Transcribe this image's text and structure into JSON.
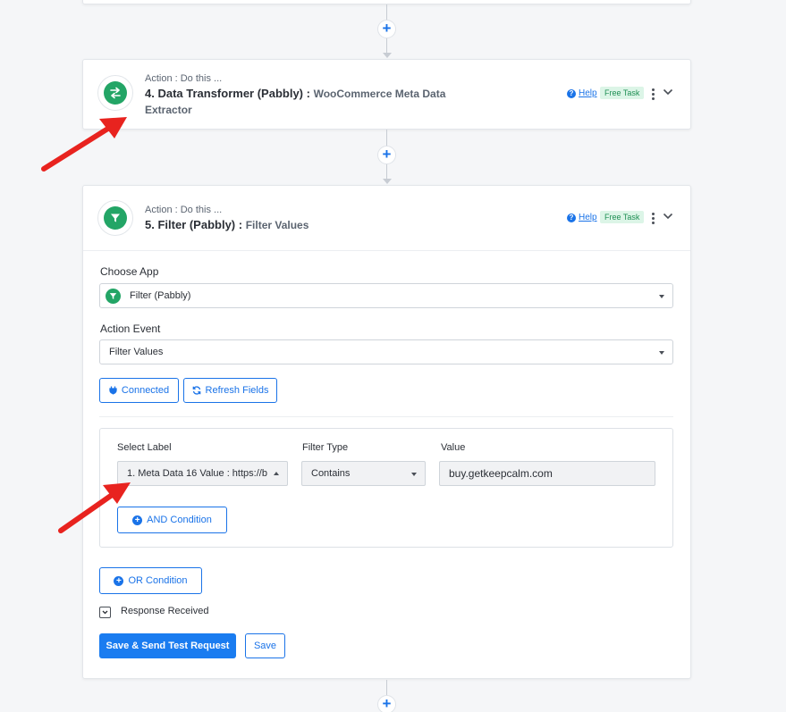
{
  "step4": {
    "subtitle": "Action : Do this ...",
    "title": "4. Data Transformer (Pabbly) :",
    "app_sub_line1": "WooCommerce Meta Data",
    "app_sub_line2": "Extractor",
    "help": "Help",
    "badge": "Free Task"
  },
  "step5": {
    "subtitle": "Action : Do this ...",
    "title": "5. Filter (Pabbly) :",
    "app_sub": "Filter Values",
    "help": "Help",
    "badge": "Free Task",
    "choose_app_label": "Choose App",
    "choose_app_value": "Filter (Pabbly)",
    "action_event_label": "Action Event",
    "action_event_value": "Filter Values",
    "connected_btn": "Connected",
    "refresh_btn": "Refresh Fields",
    "condition": {
      "select_label_header": "Select Label",
      "filter_type_header": "Filter Type",
      "value_header": "Value",
      "select_label_value": "1. Meta Data 16 Value : https://b",
      "filter_type_value": "Contains",
      "value_value": "buy.getkeepcalm.com",
      "and_btn": "AND Condition"
    },
    "or_btn": "OR Condition",
    "response_received": "Response Received",
    "save_send_btn": "Save & Send Test Request",
    "save_btn": "Save"
  },
  "colors": {
    "accent": "#1a73e8",
    "brand_green": "#23a566",
    "annotation_red": "#e8231f"
  }
}
